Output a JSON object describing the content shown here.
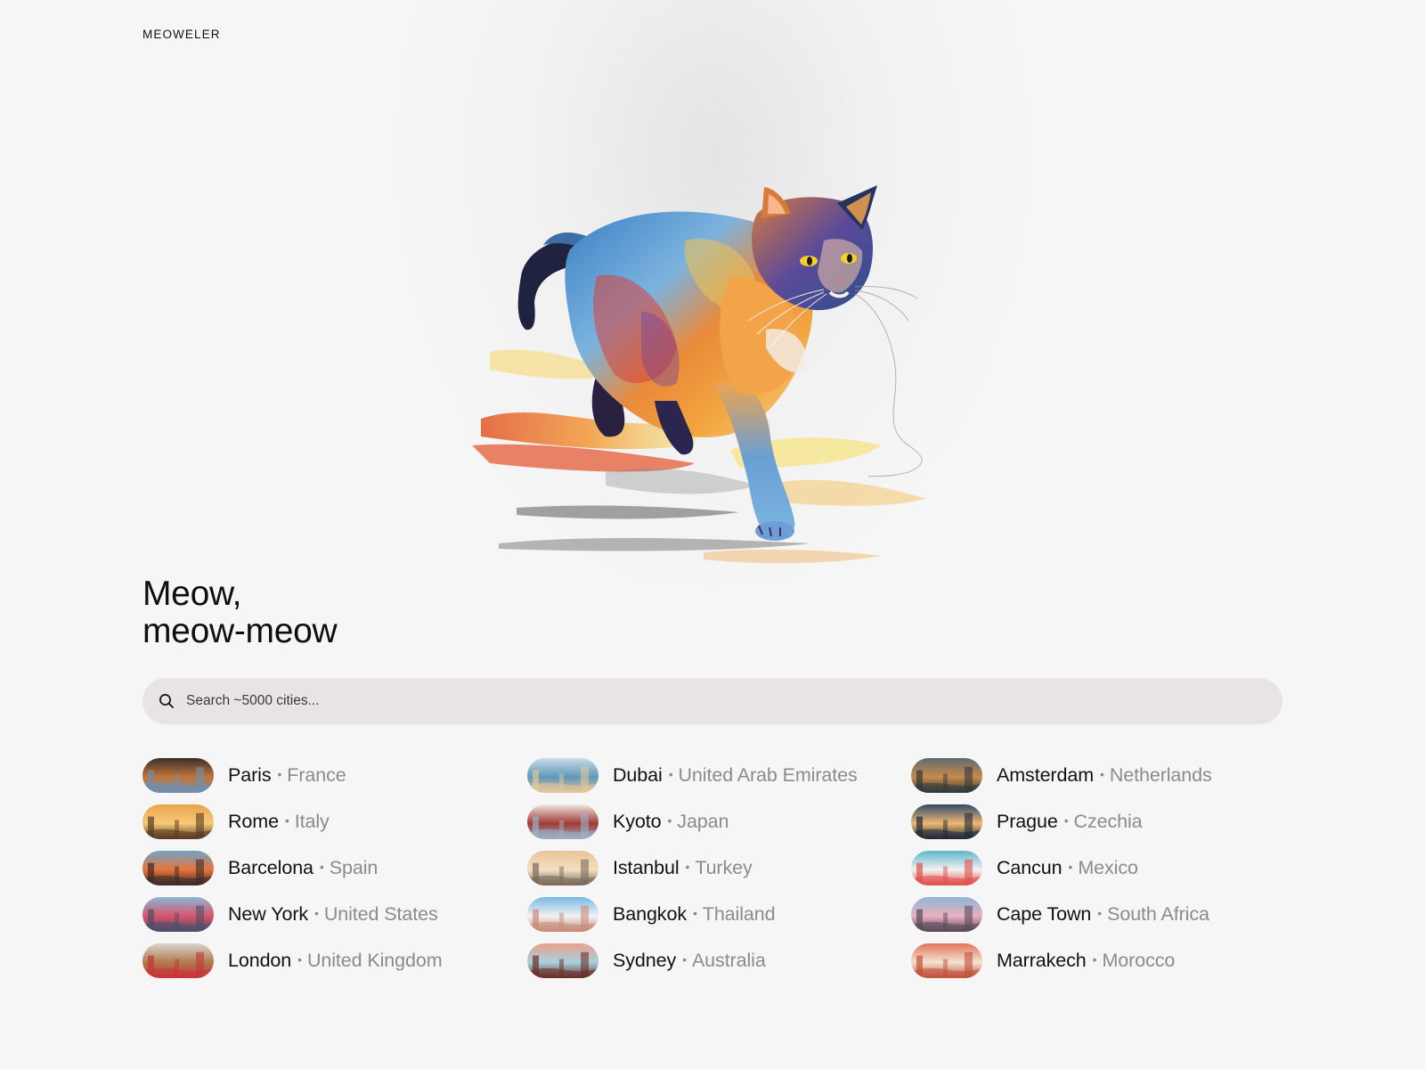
{
  "app": {
    "logo": "MEOWELER"
  },
  "hero": {
    "image": "colorful-walking-cat-illustration",
    "heading_line1": "Meow,",
    "heading_line2": "meow-meow"
  },
  "search": {
    "icon": "search-icon",
    "placeholder": "Search ~5000 cities...",
    "value": ""
  },
  "separator": "•",
  "cities": {
    "columns": [
      [
        {
          "city": "Paris",
          "country": "France",
          "colors": [
            "#3b2f2a",
            "#c2763a",
            "#6f8fb0"
          ]
        },
        {
          "city": "Rome",
          "country": "Italy",
          "colors": [
            "#e9a34b",
            "#f6c978",
            "#5a3a22"
          ]
        },
        {
          "city": "Barcelona",
          "country": "Spain",
          "colors": [
            "#6fa3c8",
            "#e8743a",
            "#3c2a2a"
          ]
        },
        {
          "city": "New York",
          "country": "United States",
          "colors": [
            "#8bb7d8",
            "#d8546a",
            "#4c4f6a"
          ]
        },
        {
          "city": "London",
          "country": "United Kingdom",
          "colors": [
            "#d9d5cf",
            "#b07a4a",
            "#c8343a"
          ]
        }
      ],
      [
        {
          "city": "Dubai",
          "country": "United Arab Emirates",
          "colors": [
            "#c9dcea",
            "#5f97b8",
            "#e2c79a"
          ]
        },
        {
          "city": "Kyoto",
          "country": "Japan",
          "colors": [
            "#f1e7de",
            "#a03a34",
            "#9bb0c8"
          ]
        },
        {
          "city": "Istanbul",
          "country": "Turkey",
          "colors": [
            "#e9c39a",
            "#f3dfc0",
            "#7a6a5c"
          ]
        },
        {
          "city": "Bangkok",
          "country": "Thailand",
          "colors": [
            "#78b8e4",
            "#f2f2f2",
            "#c98a78"
          ]
        },
        {
          "city": "Sydney",
          "country": "Australia",
          "colors": [
            "#e9a08a",
            "#a8d2df",
            "#6a2e28"
          ]
        }
      ],
      [
        {
          "city": "Amsterdam",
          "country": "Netherlands",
          "colors": [
            "#5e6a6e",
            "#c98a4a",
            "#2f3a3c"
          ]
        },
        {
          "city": "Prague",
          "country": "Czechia",
          "colors": [
            "#2f4a6a",
            "#f0b873",
            "#1f2a38"
          ]
        },
        {
          "city": "Cancun",
          "country": "Mexico",
          "colors": [
            "#5fb5c8",
            "#f2f2f2",
            "#e0504a"
          ]
        },
        {
          "city": "Cape Town",
          "country": "South Africa",
          "colors": [
            "#8fb6d8",
            "#e9b0c0",
            "#5a4a5a"
          ]
        },
        {
          "city": "Marrakech",
          "country": "Morocco",
          "colors": [
            "#e4745a",
            "#f2e3d0",
            "#c2503a"
          ]
        }
      ]
    ]
  }
}
